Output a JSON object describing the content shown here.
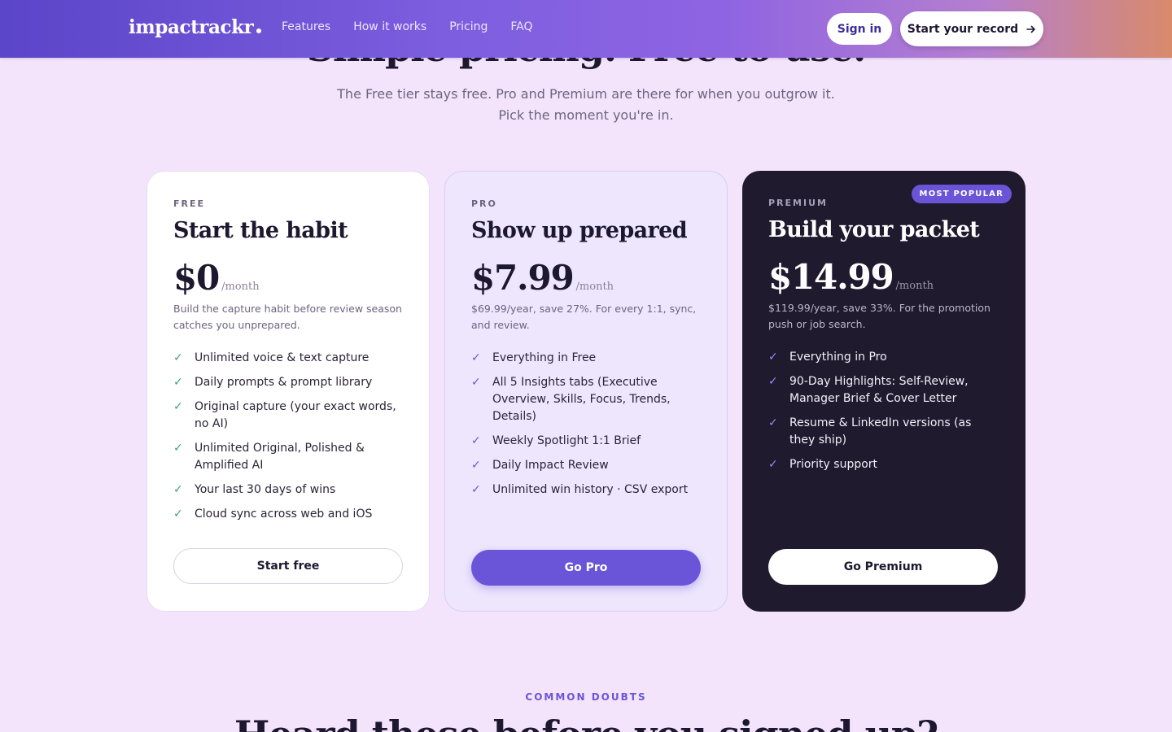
{
  "header": {
    "logo": "impactrackr",
    "nav": [
      "Features",
      "How it works",
      "Pricing",
      "FAQ"
    ],
    "sign_in": "Sign in",
    "start_record": "Start your record"
  },
  "hero": {
    "title": "Simple pricing. Free to use.",
    "subtitle_line1": "The Free tier stays free. Pro and Premium are there for when you outgrow it.",
    "subtitle_line2": "Pick the moment you're in."
  },
  "plans": [
    {
      "tier": "FREE",
      "title": "Start the habit",
      "price": "$0",
      "per": "/month",
      "note": "Build the capture habit before review season catches you unprepared.",
      "features": [
        "Unlimited voice & text capture",
        "Daily prompts & prompt library",
        "Original capture (your exact words, no AI)",
        "Unlimited Original, Polished & Amplified AI",
        "Your last 30 days of wins",
        "Cloud sync across web and iOS"
      ],
      "cta": "Start free"
    },
    {
      "tier": "PRO",
      "title": "Show up prepared",
      "price": "$7.99",
      "per": "/month",
      "note": "$69.99/year, save 27%. For every 1:1, sync, and review.",
      "features": [
        "Everything in Free",
        "All 5 Insights tabs (Executive Overview, Skills, Focus, Trends, Details)",
        "Weekly Spotlight 1:1 Brief",
        "Daily Impact Review",
        "Unlimited win history · CSV export"
      ],
      "cta": "Go Pro"
    },
    {
      "tier": "PREMIUM",
      "badge": "MOST POPULAR",
      "title": "Build your packet",
      "price": "$14.99",
      "per": "/month",
      "note": "$119.99/year, save 33%. For the promotion push or job search.",
      "features": [
        "Everything in Pro",
        "90-Day Highlights: Self-Review, Manager Brief & Cover Letter",
        "Resume & LinkedIn versions (as they ship)",
        "Priority support"
      ],
      "cta": "Go Premium"
    }
  ],
  "doubts": {
    "eyebrow": "COMMON DOUBTS",
    "title": "Heard these before you signed up?"
  },
  "icons": {
    "check": "check-icon",
    "arrow": "arrow-right-icon"
  },
  "colors": {
    "accent": "#6a55d8",
    "page_bg": "#f3e4fb",
    "premium_bg": "#1f1a2e",
    "free_check": "#3aa36a"
  }
}
